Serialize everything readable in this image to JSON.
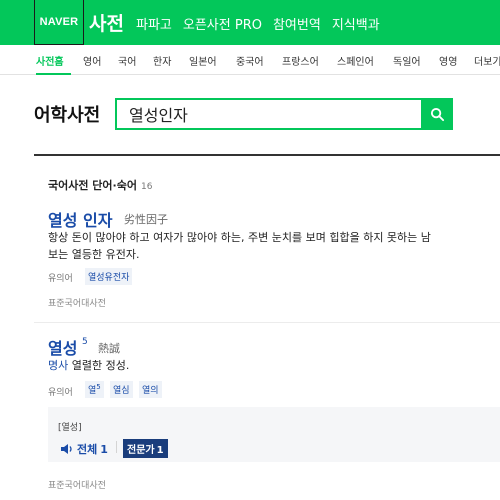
{
  "header": {
    "logo": "NAVER",
    "brand": "사전",
    "nav": [
      "파파고",
      "오픈사전 PRO",
      "참여번역",
      "지식백과"
    ]
  },
  "lang_nav": [
    "사전홈",
    "영어",
    "국어",
    "한자",
    "일본어",
    "중국어",
    "프랑스어",
    "스페인어",
    "독일어",
    "영영",
    "더보기"
  ],
  "search": {
    "title": "어학사전",
    "query": "열성인자"
  },
  "section": {
    "title": "국어사전 단어·숙어",
    "count": "16"
  },
  "entries": [
    {
      "headword": "열성 인자",
      "hanja": "劣性因子",
      "def_line1": "항상 돈이 많아야 하고 여자가 많아야 하는, 주변 눈치를 보며 힙합을 하지 못하는 남",
      "def_line2": "보는 열등한 유전자.",
      "rel_label": "유의어",
      "synonyms": [
        "열성유전자"
      ],
      "source": "표준국어대사전"
    },
    {
      "headword": "열성",
      "sup": "5",
      "hanja": "熱誠",
      "pos": "명사",
      "definition": "열렬한 정성.",
      "rel_label": "유의어",
      "synonyms": [
        {
          "word": "열",
          "sup": "5"
        },
        {
          "word": "열심",
          "sup": ""
        },
        {
          "word": "열의",
          "sup": ""
        }
      ],
      "example": {
        "title": "[열성]",
        "audio_label": "전체",
        "audio_count": "1",
        "badge_label": "전문가",
        "badge_count": "1"
      },
      "source": "표준국어대사전"
    }
  ],
  "colors": {
    "brand_green": "#03c75a",
    "link_blue": "#1a4ca8",
    "badge_navy": "#1a3d7c"
  }
}
